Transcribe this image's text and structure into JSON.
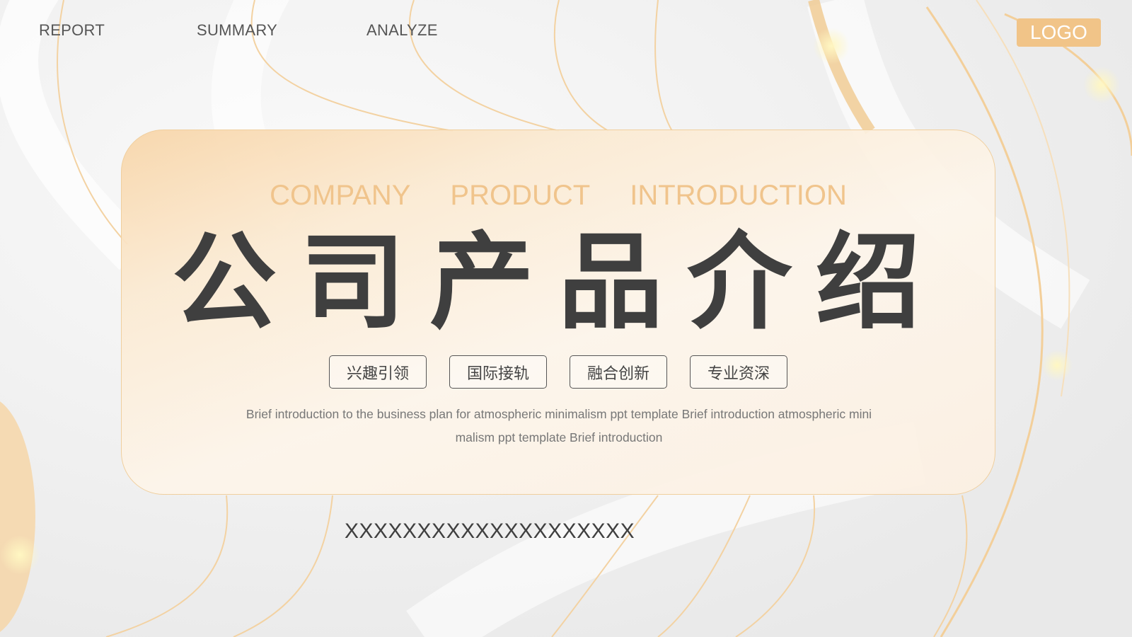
{
  "nav": {
    "items": [
      {
        "label": "REPORT"
      },
      {
        "label": "SUMMARY"
      },
      {
        "label": "ANALYZE"
      }
    ]
  },
  "logo": {
    "label": "LOGO"
  },
  "card": {
    "en_title": [
      "COMPANY",
      "PRODUCT",
      "INTRODUCTION"
    ],
    "cn_title": "公司产品介绍",
    "tags": [
      {
        "label": "兴趣引领"
      },
      {
        "label": "国际接轨"
      },
      {
        "label": "融合创新"
      },
      {
        "label": "专业资深"
      }
    ],
    "description": "Brief introduction to the business plan for atmospheric minimalism ppt template Brief introduction atmospheric minimalism ppt template Brief introduction"
  },
  "footer": {
    "text": "XXXXXXXXXXXXXXXXXXXX"
  },
  "colors": {
    "accent": "#f1c488",
    "title_en": "#f0c48c",
    "text_dark": "#3f3f3f",
    "card_border": "#f0cf9e"
  }
}
